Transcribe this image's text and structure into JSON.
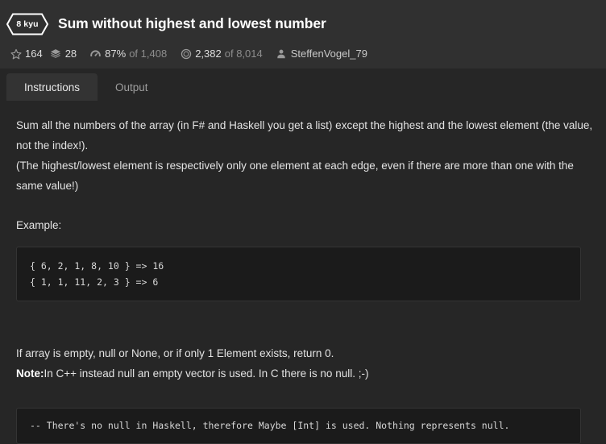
{
  "header": {
    "rank": "8 kyu",
    "title": "Sum without highest and lowest number",
    "stats": {
      "stars_icon": "star-icon",
      "stars": "164",
      "forks_icon": "layers-icon",
      "forks": "28",
      "satisfaction_icon": "gauge-icon",
      "satisfaction_pct": "87%",
      "satisfaction_of": "of 1,408",
      "completions_icon": "clock-icon",
      "completions": "2,382",
      "completions_of": "of 8,014",
      "author_icon": "person-icon",
      "author": "SteffenVogel_79"
    }
  },
  "tabs": [
    {
      "label": "Instructions",
      "active": true
    },
    {
      "label": "Output",
      "active": false
    }
  ],
  "instructions": {
    "p1": "Sum all the numbers of the array (in F# and Haskell you get a list) except the highest and the lowest element (the value, not the index!).",
    "p2": "(The highest/lowest element is respectively only one element at each edge, even if there are more than one with the same value!)",
    "example_label": "Example:",
    "example_code": "{ 6, 2, 1, 8, 10 } => 16\n{ 1, 1, 11, 2, 3 } => 6",
    "p3": "If array is empty, null or None, or if only 1 Element exists, return 0.",
    "note_label": "Note:",
    "note_text": "In C++ instead null an empty vector is used. In C there is no null. ;-)",
    "haskell_code": "-- There's no null in Haskell, therefore Maybe [Int] is used. Nothing represents null."
  },
  "colors": {
    "page_bg": "#262626",
    "header_bg": "#303030",
    "active_tab_bg": "#333333",
    "code_bg": "#1b1b1b",
    "text": "#e3e3e3",
    "muted": "#8d8d8d"
  }
}
